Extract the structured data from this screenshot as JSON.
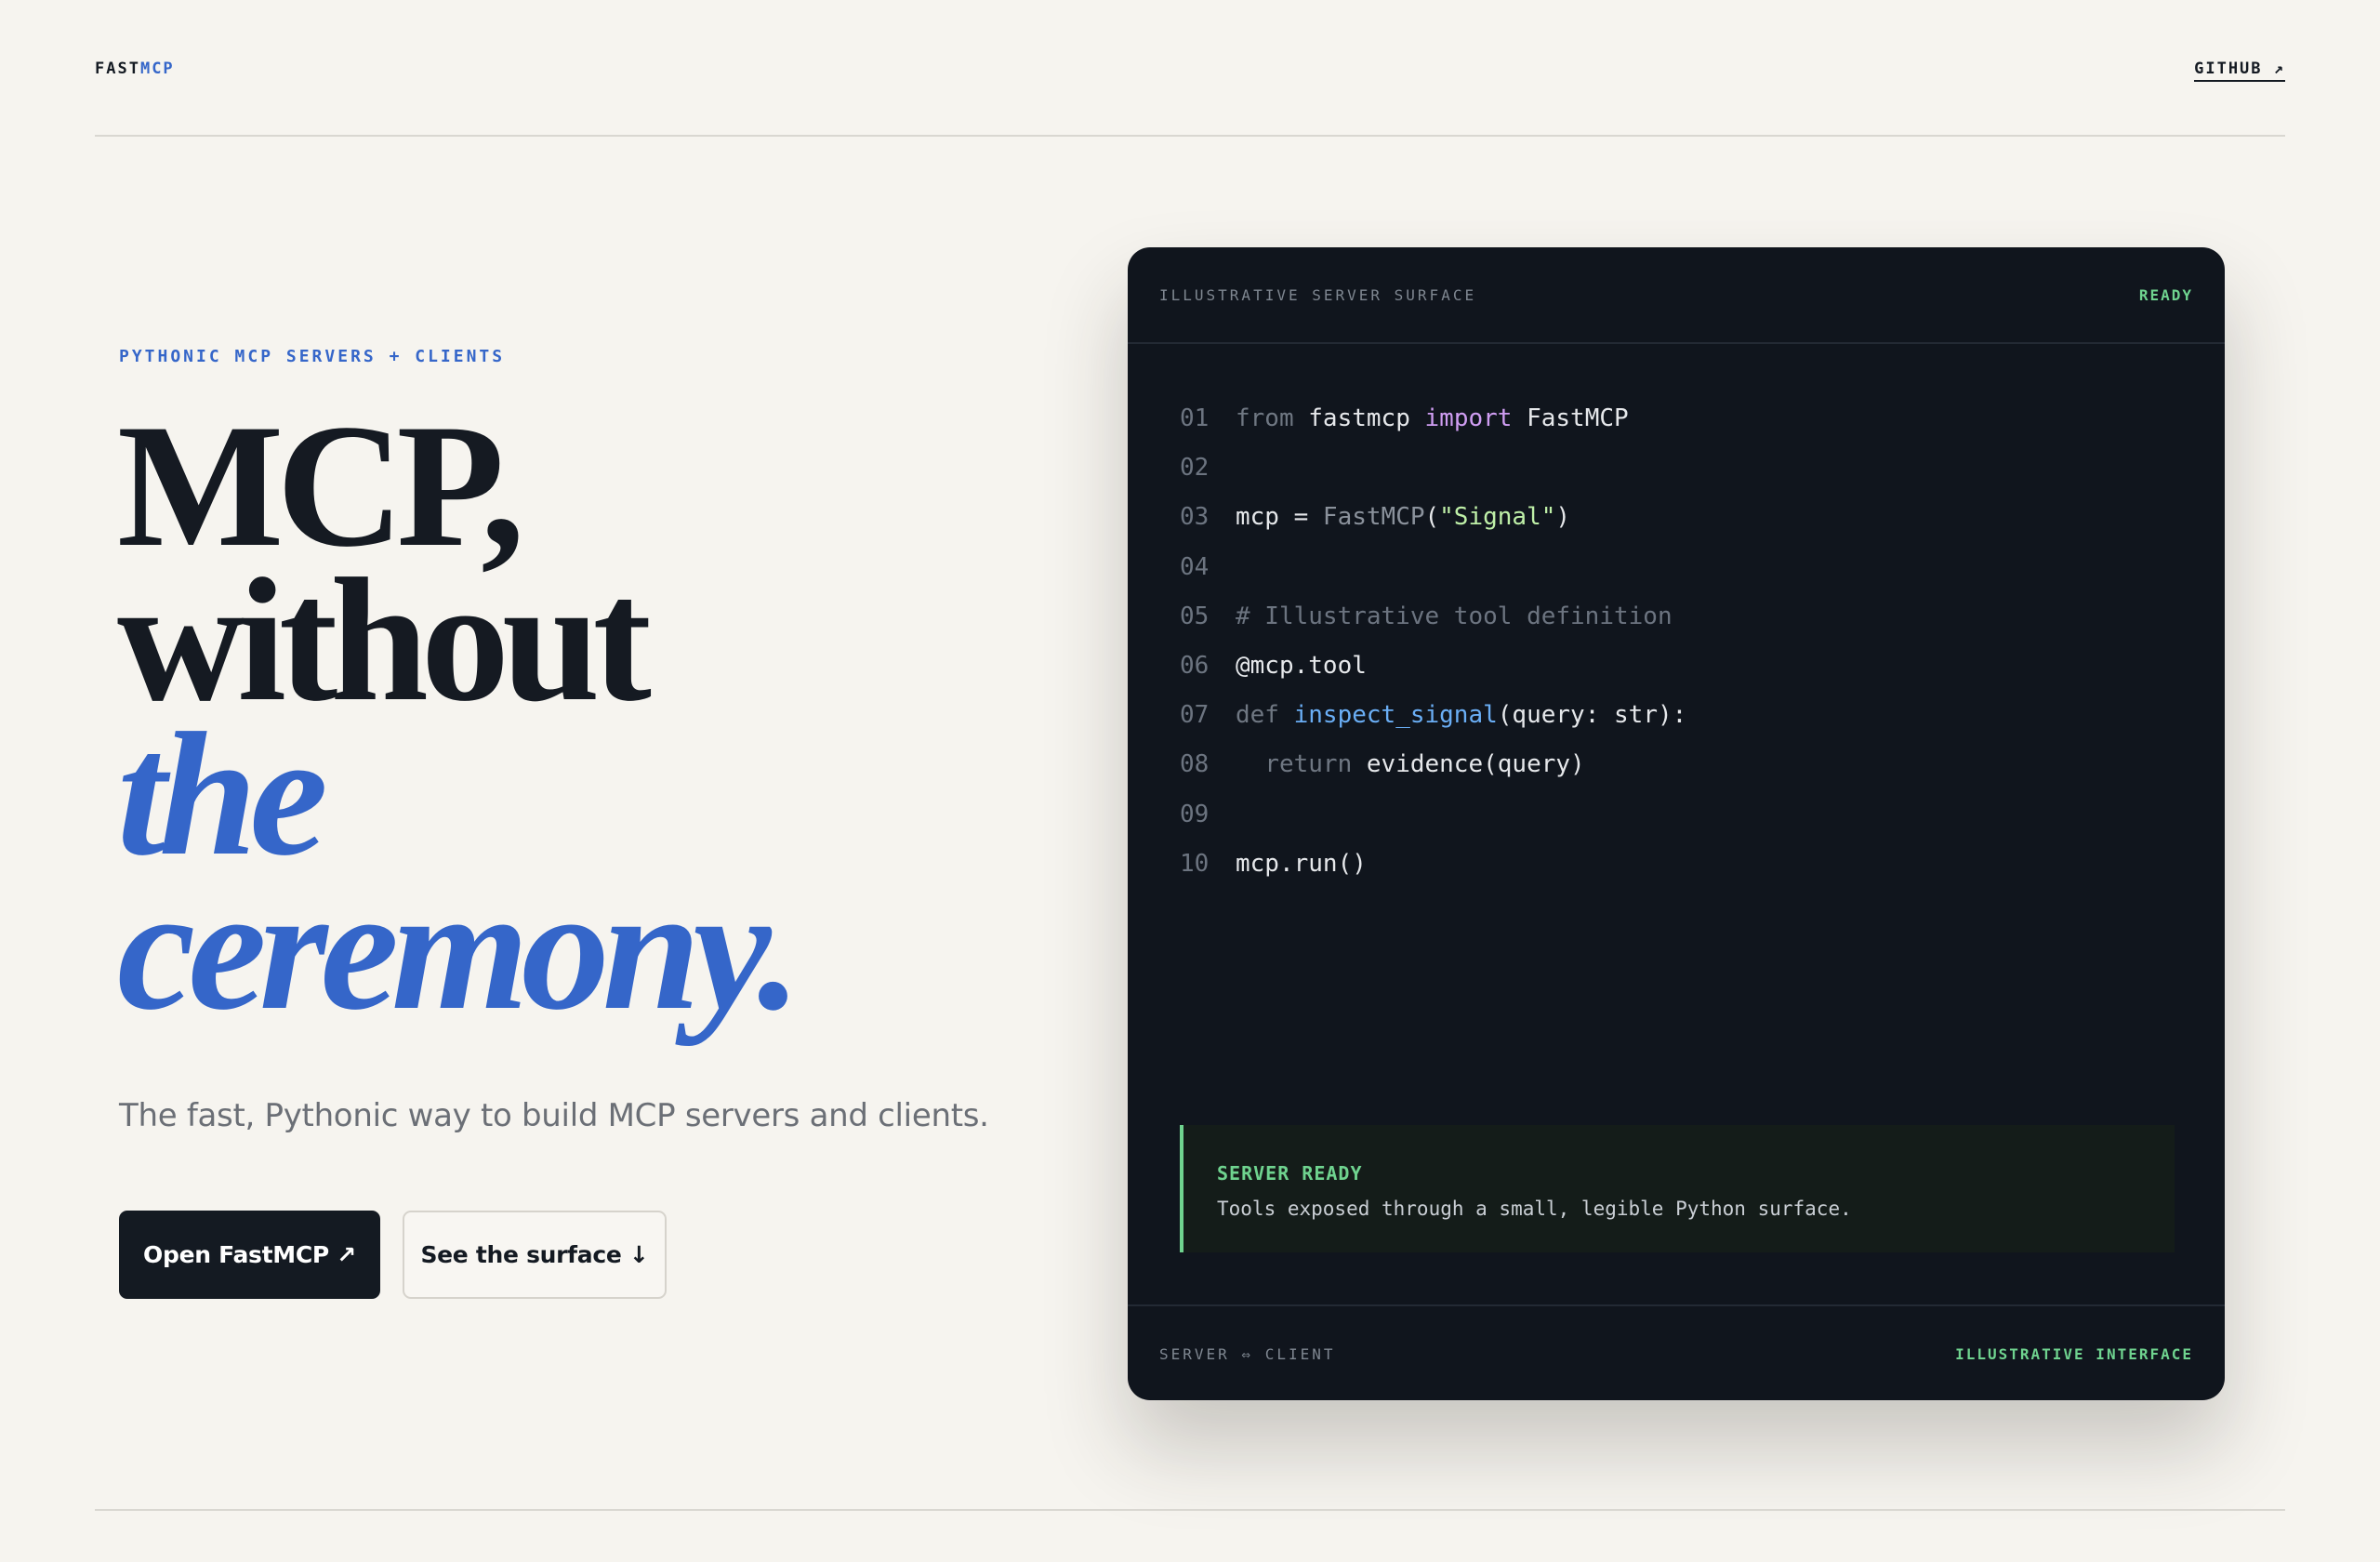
{
  "header": {
    "brand_part1": "FAST",
    "brand_part2": "MCP",
    "github_link": "GITHUB ↗"
  },
  "hero": {
    "eyebrow": "PYTHONIC MCP SERVERS + CLIENTS",
    "headline_line1": "MCP,",
    "headline_line2": "without",
    "headline_line3": "the",
    "headline_line4": "ceremony.",
    "subhead": "The fast, Pythonic way to build MCP servers and clients.",
    "primary_button": "Open FastMCP ↗",
    "secondary_button": "See the surface ↓"
  },
  "card": {
    "title": "ILLUSTRATIVE SERVER SURFACE",
    "status": "READY",
    "code": {
      "line_numbers": [
        "01",
        "02",
        "03",
        "04",
        "05",
        "06",
        "07",
        "08",
        "09",
        "10"
      ],
      "l01_from": "from",
      "l01_mod": " fastmcp ",
      "l01_import": "import",
      "l01_cls": " FastMCP",
      "l03_var": "mcp = ",
      "l03_cls": "FastMCP",
      "l03_open": "(",
      "l03_str": "\"Signal\"",
      "l03_close": ")",
      "l05_comment": "# Illustrative tool definition",
      "l06_decorator": "@mcp.tool",
      "l07_def": "def ",
      "l07_fn": "inspect_signal",
      "l07_args": "(query: str):",
      "l08_indent": "  ",
      "l08_return": "return",
      "l08_call": " evidence(query)",
      "l10_call": "mcp.run()"
    },
    "notice_title": "SERVER READY",
    "notice_body": "Tools exposed through a small, legible Python surface.",
    "footer_left": "SERVER ⇔ CLIENT",
    "footer_right": "ILLUSTRATIVE INTERFACE"
  },
  "colors": {
    "background": "#f6f4ef",
    "accent_blue": "#3566c9",
    "ink": "#141a22",
    "card_bg": "#10151d",
    "ready_green": "#6fd38f"
  }
}
